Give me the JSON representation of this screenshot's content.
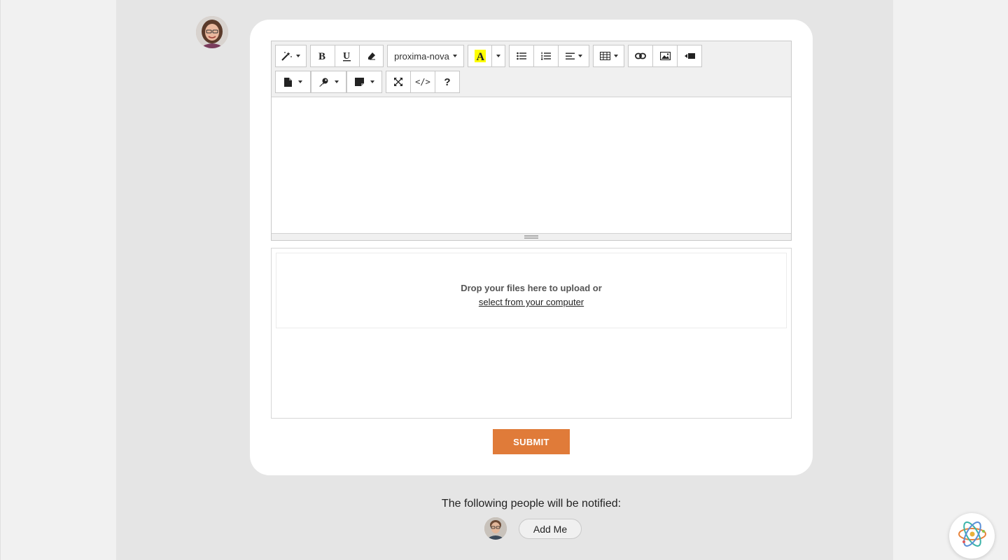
{
  "layout": {
    "colors": {
      "accent": "#e07b39",
      "content_bg": "#e5e5e5",
      "side_bg": "#f1f1f1",
      "card_bg": "#ffffff",
      "highlight": "#ffff00"
    }
  },
  "toolbar": {
    "row1": [
      {
        "name": "magic-wand-style-dropdown",
        "icon": "magic-wand-icon",
        "dropdown": true
      },
      {
        "name": "bold-button",
        "icon": "bold-icon"
      },
      {
        "name": "underline-button",
        "icon": "underline-icon"
      },
      {
        "name": "clear-formatting-button",
        "icon": "eraser-icon"
      },
      {
        "name": "font-family-dropdown",
        "label": "proxima-nova",
        "dropdown": true
      },
      {
        "name": "text-color-button",
        "icon": "highlight-a-icon"
      },
      {
        "name": "text-color-dropdown",
        "icon": "caret-icon",
        "dropdown": true
      },
      {
        "name": "unordered-list-button",
        "icon": "bullet-list-icon"
      },
      {
        "name": "ordered-list-button",
        "icon": "numbered-list-icon"
      },
      {
        "name": "paragraph-align-dropdown",
        "icon": "align-left-icon",
        "dropdown": true
      },
      {
        "name": "table-dropdown",
        "icon": "table-icon",
        "dropdown": true
      },
      {
        "name": "link-button",
        "icon": "link-icon"
      },
      {
        "name": "image-button",
        "icon": "image-icon"
      },
      {
        "name": "video-button",
        "icon": "video-icon"
      }
    ],
    "row2": [
      {
        "name": "template-dropdown",
        "icon": "file-icon",
        "dropdown": true
      },
      {
        "name": "key-dropdown",
        "icon": "key-icon",
        "dropdown": true
      },
      {
        "name": "note-dropdown",
        "icon": "sticky-note-icon",
        "dropdown": true
      },
      {
        "name": "fullscreen-button",
        "icon": "expand-icon"
      },
      {
        "name": "code-view-button",
        "label": "</>",
        "icon": "code-icon"
      },
      {
        "name": "help-button",
        "label": "?",
        "icon": "question-icon"
      }
    ],
    "font_family_label": "proxima-nova",
    "code_label": "</>",
    "help_label": "?"
  },
  "upload": {
    "drop_text": "Drop your files here to upload or",
    "select_link": "select from your computer"
  },
  "form": {
    "submit_label": "SUBMIT"
  },
  "notify": {
    "heading": "The following people will be notified:",
    "add_me_label": "Add Me"
  },
  "widget": {
    "icon": "atom-icon"
  }
}
